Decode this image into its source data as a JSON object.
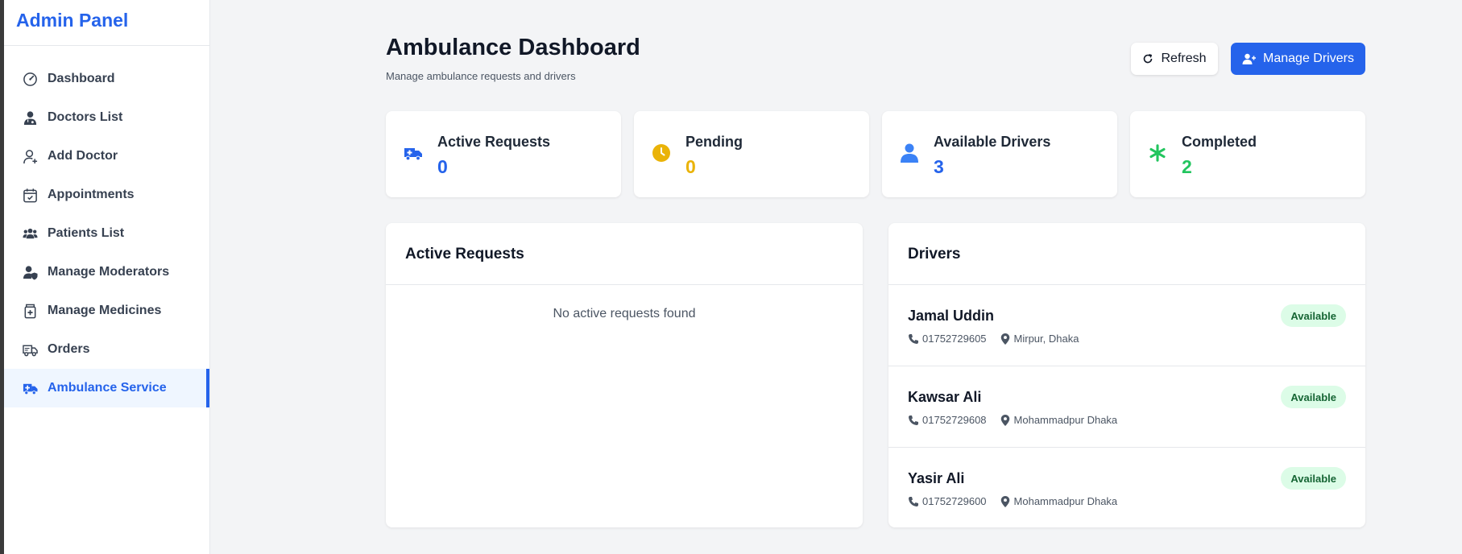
{
  "sidebar": {
    "brand": "Admin Panel",
    "items": [
      {
        "label": "Dashboard",
        "icon": "gauge-icon"
      },
      {
        "label": "Doctors List",
        "icon": "user-doctor-icon"
      },
      {
        "label": "Add Doctor",
        "icon": "user-add-icon"
      },
      {
        "label": "Appointments",
        "icon": "calendar-check-icon"
      },
      {
        "label": "Patients List",
        "icon": "users-icon"
      },
      {
        "label": "Manage Moderators",
        "icon": "user-shield-icon"
      },
      {
        "label": "Manage Medicines",
        "icon": "medicine-jar-icon"
      },
      {
        "label": "Orders",
        "icon": "truck-icon"
      },
      {
        "label": "Ambulance Service",
        "icon": "ambulance-icon",
        "active": true
      }
    ]
  },
  "header": {
    "title": "Ambulance Dashboard",
    "subtitle": "Manage ambulance requests and drivers",
    "refresh_label": "Refresh",
    "manage_label": "Manage Drivers"
  },
  "stats": [
    {
      "label": "Active Requests",
      "value": "0",
      "color": "#2563eb",
      "icon": "ambulance-icon"
    },
    {
      "label": "Pending",
      "value": "0",
      "color": "#eab308",
      "icon": "clock-icon"
    },
    {
      "label": "Available Drivers",
      "value": "3",
      "color": "#2563eb",
      "icon": "user-icon"
    },
    {
      "label": "Completed",
      "value": "2",
      "color": "#22c55e",
      "icon": "asterisk-icon"
    }
  ],
  "requests": {
    "title": "Active Requests",
    "empty_text": "No active requests found"
  },
  "drivers": {
    "title": "Drivers",
    "list": [
      {
        "name": "Jamal Uddin",
        "phone": "01752729605",
        "location": "Mirpur, Dhaka",
        "status": "Available"
      },
      {
        "name": "Kawsar Ali",
        "phone": "01752729608",
        "location": "Mohammadpur Dhaka",
        "status": "Available"
      },
      {
        "name": "Yasir Ali",
        "phone": "01752729600",
        "location": "Mohammadpur Dhaka",
        "status": "Available"
      }
    ]
  },
  "colors": {
    "accent": "#2563eb",
    "pending": "#eab308",
    "completed": "#22c55e",
    "badge_bg": "#dcfce7",
    "badge_text": "#166534"
  }
}
